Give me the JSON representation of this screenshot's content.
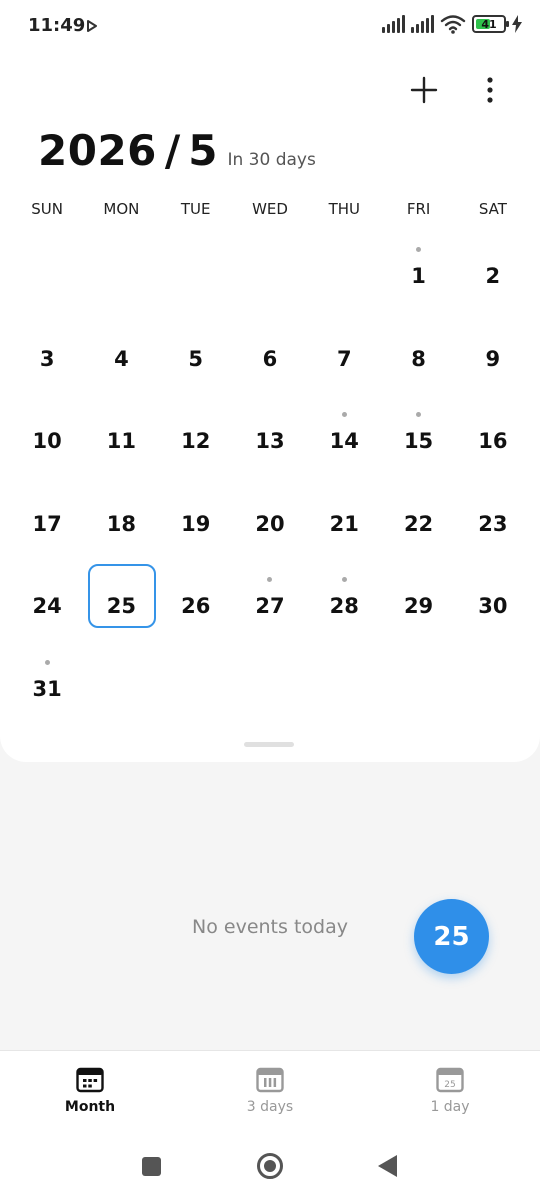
{
  "status_bar": {
    "time": "11:49",
    "battery": "41"
  },
  "header": {
    "year": "2026",
    "separator": "/",
    "month": "5",
    "subtitle": "In 30 days"
  },
  "weekdays": [
    "SUN",
    "MON",
    "TUE",
    "WED",
    "THU",
    "FRI",
    "SAT"
  ],
  "calendar": {
    "selected_day": "25",
    "days": [
      {
        "day": "",
        "dot": false
      },
      {
        "day": "",
        "dot": false
      },
      {
        "day": "",
        "dot": false
      },
      {
        "day": "",
        "dot": false
      },
      {
        "day": "",
        "dot": false
      },
      {
        "day": "1",
        "dot": true
      },
      {
        "day": "2",
        "dot": false
      },
      {
        "day": "3",
        "dot": false
      },
      {
        "day": "4",
        "dot": false
      },
      {
        "day": "5",
        "dot": false
      },
      {
        "day": "6",
        "dot": false
      },
      {
        "day": "7",
        "dot": false
      },
      {
        "day": "8",
        "dot": false
      },
      {
        "day": "9",
        "dot": false
      },
      {
        "day": "10",
        "dot": false
      },
      {
        "day": "11",
        "dot": false
      },
      {
        "day": "12",
        "dot": false
      },
      {
        "day": "13",
        "dot": false
      },
      {
        "day": "14",
        "dot": true
      },
      {
        "day": "15",
        "dot": true
      },
      {
        "day": "16",
        "dot": false
      },
      {
        "day": "17",
        "dot": false
      },
      {
        "day": "18",
        "dot": false
      },
      {
        "day": "19",
        "dot": false
      },
      {
        "day": "20",
        "dot": false
      },
      {
        "day": "21",
        "dot": false
      },
      {
        "day": "22",
        "dot": false
      },
      {
        "day": "23",
        "dot": false
      },
      {
        "day": "24",
        "dot": false
      },
      {
        "day": "25",
        "dot": false
      },
      {
        "day": "26",
        "dot": false
      },
      {
        "day": "27",
        "dot": true
      },
      {
        "day": "28",
        "dot": true
      },
      {
        "day": "29",
        "dot": false
      },
      {
        "day": "30",
        "dot": false
      },
      {
        "day": "31",
        "dot": true
      }
    ]
  },
  "events": {
    "empty_text": "No events today",
    "today_button": "25"
  },
  "tabs": [
    {
      "label": "Month",
      "icon": "month-grid-icon",
      "active": true
    },
    {
      "label": "3 days",
      "icon": "three-days-icon",
      "active": false
    },
    {
      "label": "1 day",
      "icon": "one-day-icon",
      "active": false,
      "icon_text": "25"
    }
  ],
  "colors": {
    "accent": "#2f8fe9",
    "selected_border": "#3594e8",
    "dot": "#aaaaaa",
    "battery_fill": "#2fc14b"
  }
}
